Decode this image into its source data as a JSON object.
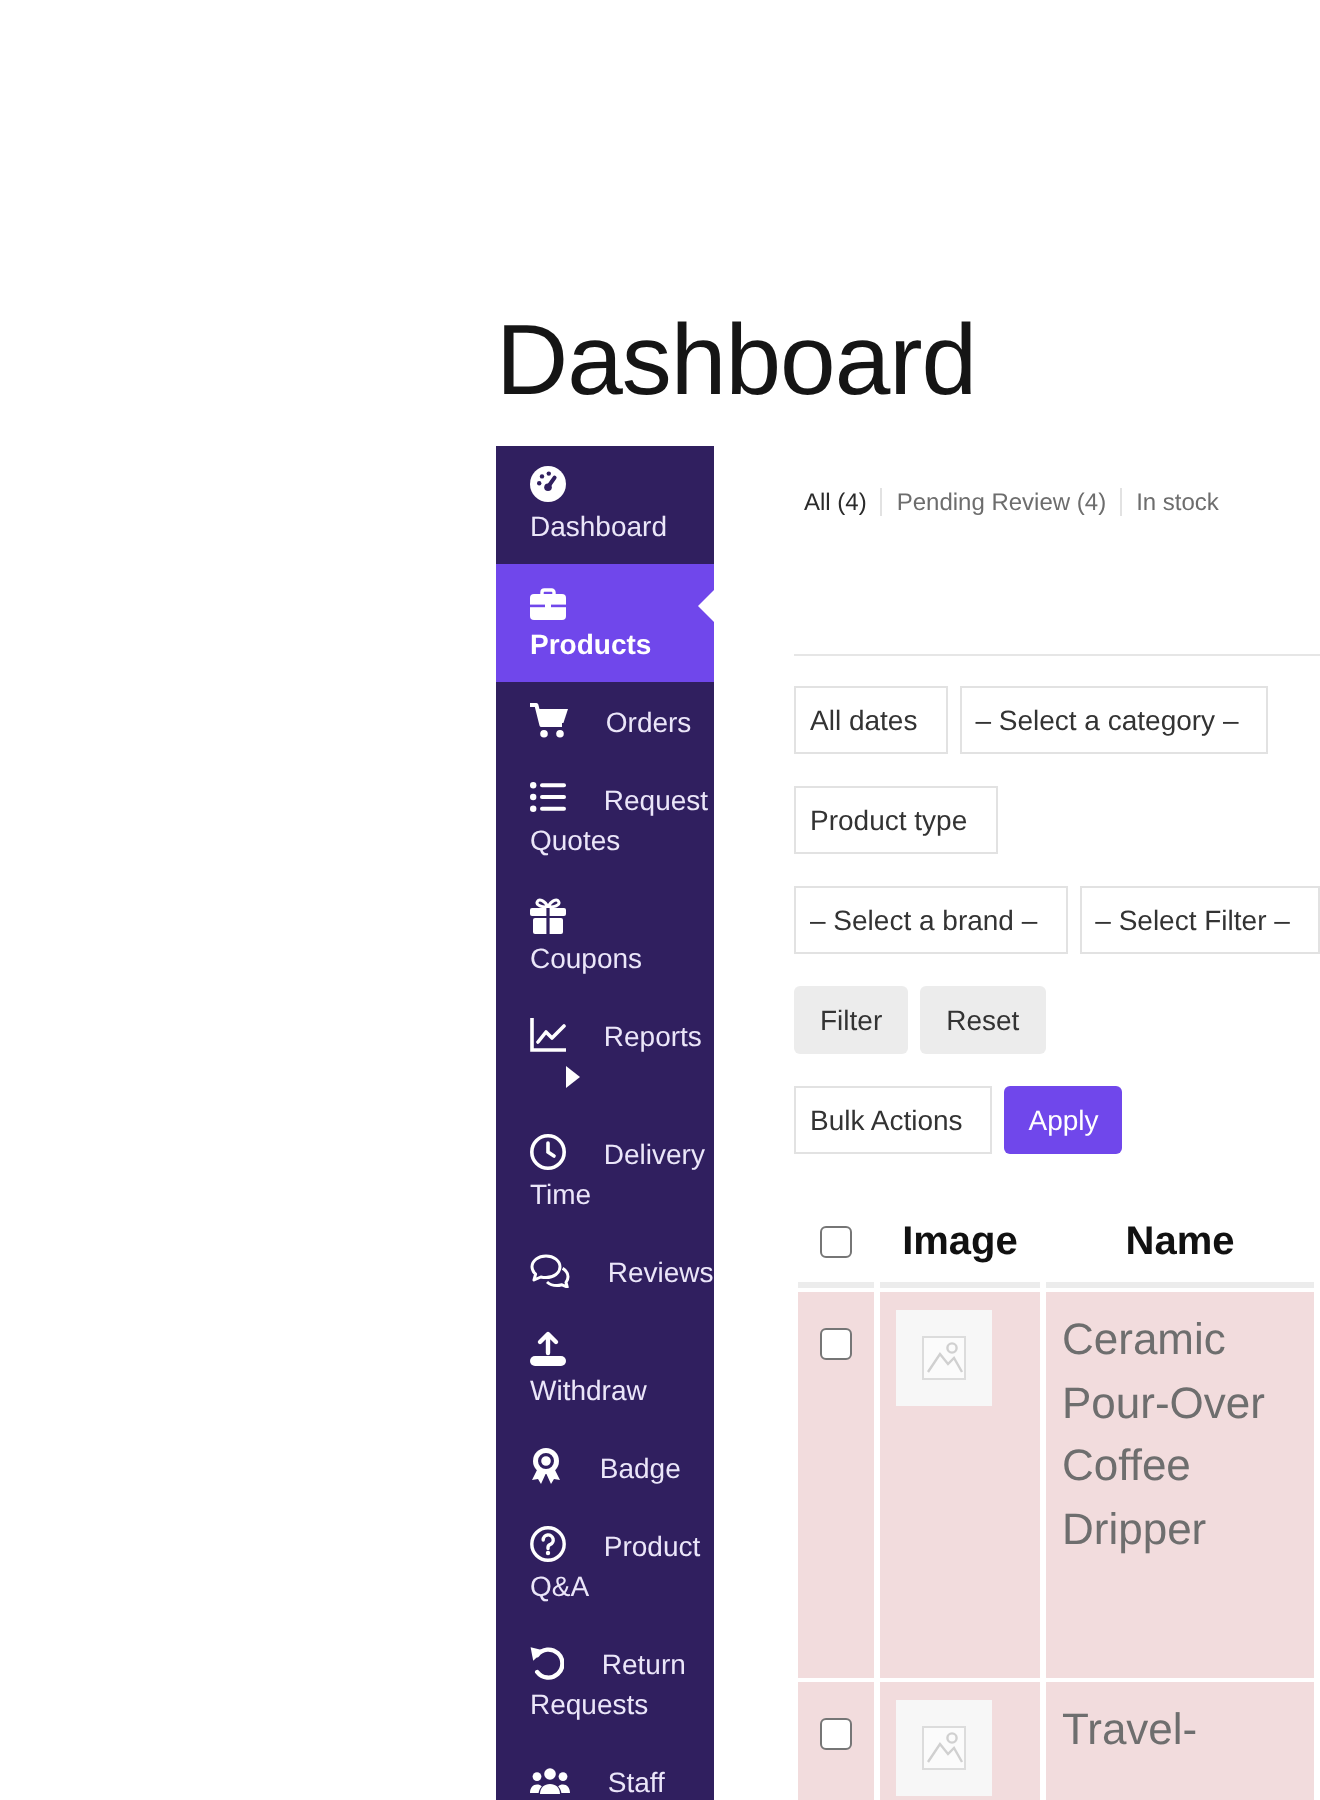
{
  "page": {
    "title": "Dashboard"
  },
  "sidebar": {
    "items": [
      {
        "label": "Dashboard",
        "selected": false,
        "submenu": false
      },
      {
        "label": "Products",
        "selected": true,
        "submenu": false
      },
      {
        "label": "Orders",
        "selected": false,
        "submenu": false
      },
      {
        "label": "Request Quotes",
        "selected": false,
        "submenu": false
      },
      {
        "label": "Coupons",
        "selected": false,
        "submenu": false
      },
      {
        "label": "Reports",
        "selected": false,
        "submenu": true
      },
      {
        "label": "Delivery Time",
        "selected": false,
        "submenu": false
      },
      {
        "label": "Reviews",
        "selected": false,
        "submenu": false
      },
      {
        "label": "Withdraw",
        "selected": false,
        "submenu": false
      },
      {
        "label": "Badge",
        "selected": false,
        "submenu": false
      },
      {
        "label": "Product Q&A",
        "selected": false,
        "submenu": false
      },
      {
        "label": "Return Requests",
        "selected": false,
        "submenu": false
      },
      {
        "label": "Staff",
        "selected": false,
        "submenu": false
      }
    ]
  },
  "status_tabs": [
    {
      "label": "All (4)",
      "selected": true
    },
    {
      "label": "Pending Review (4)",
      "selected": false
    },
    {
      "label": "In stock",
      "selected": false
    }
  ],
  "toolbar_rows": [
    [
      {
        "kind": "select",
        "value": "All dates"
      },
      {
        "kind": "select",
        "value": "– Select a category –"
      }
    ],
    [
      {
        "kind": "select",
        "value": "Product type"
      }
    ],
    [
      {
        "kind": "select",
        "value": "– Select a brand –"
      },
      {
        "kind": "select",
        "value": "– Select Filter –"
      }
    ],
    [
      {
        "kind": "button",
        "label": "Filter"
      },
      {
        "kind": "button",
        "label": "Reset"
      }
    ],
    [
      {
        "kind": "select",
        "value": "Bulk Actions"
      },
      {
        "kind": "primary",
        "label": "Apply"
      }
    ]
  ],
  "table": {
    "select_all": {
      "checked": false
    },
    "columns": [
      "Image",
      "Name"
    ],
    "rows": [
      {
        "checked": false,
        "name": "Ceramic Pour-Over Coffee Dripper"
      },
      {
        "checked": false,
        "name": "Travel-"
      }
    ]
  }
}
